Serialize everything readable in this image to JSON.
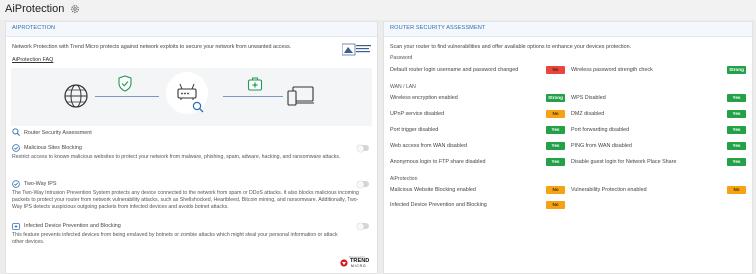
{
  "page": {
    "title": "AiProtection"
  },
  "left": {
    "header": "AIPROTECTION",
    "description": "Network Protection with Trend Micro protects against network exploits to secure your network from unwanted access.",
    "faq_link": "AiProtection FAQ",
    "assessment_label": "Router Security Assessment",
    "features": [
      {
        "title": "Malicious Sites Blocking",
        "enabled": false,
        "desc": "Restrict access to known malicious websites to protect your network from malware, phishing, spam, adware, hacking, and ransomware attacks."
      },
      {
        "title": "Two-Way IPS",
        "enabled": false,
        "desc": "The Two-Way Intrusion Prevention System protects any device connected to the network from spam or DDoS attacks. It also blocks malicious incoming packets to protect your router from network vulnerability attacks, such as Shellshocked, Heartbleed, Bitcoin mining, and ransomware. Additionally, Two-Way IPS detects suspicious outgoing packets from infected devices and avoids botnet attacks."
      },
      {
        "title": "Infected Device Prevention and Blocking",
        "enabled": false,
        "desc": "This feature prevents infected devices from being enslaved by botnets or zombie attacks which might steal your personal information or attack other devices."
      }
    ],
    "powered_by": "Powered by",
    "brand": "TREND",
    "brand_sub": "MICRO",
    "badge_logo_text": "TREND MICRO PROTECTED"
  },
  "right": {
    "header": "ROUTER SECURITY ASSESSMENT",
    "intro": "Scan your router to find vulnerabilities and offer available options to enhance your devices protection.",
    "sections": [
      {
        "title": "Password",
        "rows": [
          [
            {
              "label": "Default router login username and password changed",
              "status": "No",
              "color": "red"
            },
            {
              "label": "Wireless password strength check",
              "status": "Strong",
              "color": "green"
            }
          ]
        ]
      },
      {
        "title": "WAN / LAN",
        "rows": [
          [
            {
              "label": "Wireless encryption enabled",
              "status": "Strong",
              "color": "green"
            },
            {
              "label": "WPS Disabled",
              "status": "Yes",
              "color": "green"
            }
          ],
          [
            {
              "label": "UPnP service disabled",
              "status": "No",
              "color": "orange"
            },
            {
              "label": "DMZ disabled",
              "status": "Yes",
              "color": "green"
            }
          ],
          [
            {
              "label": "Port trigger disabled",
              "status": "Yes",
              "color": "green"
            },
            {
              "label": "Port forwarding disabled",
              "status": "Yes",
              "color": "green"
            }
          ],
          [
            {
              "label": "Web access from WAN disabled",
              "status": "Yes",
              "color": "green"
            },
            {
              "label": "PING from WAN disabled",
              "status": "Yes",
              "color": "green"
            }
          ],
          [
            {
              "label": "Anonymous login to FTP share disabled",
              "status": "Yes",
              "color": "green"
            },
            {
              "label": "Disable guest login for Network Place Share",
              "status": "Yes",
              "color": "green"
            }
          ]
        ]
      },
      {
        "title": "AiProtection",
        "rows": [
          [
            {
              "label": "Malicious Website Blocking enabled",
              "status": "No",
              "color": "orange"
            },
            {
              "label": "Vulnerability Protection enabled",
              "status": "No",
              "color": "orange"
            }
          ],
          [
            {
              "label": "Infected Device Prevention and Blocking",
              "status": "No",
              "color": "orange"
            }
          ]
        ]
      }
    ]
  }
}
